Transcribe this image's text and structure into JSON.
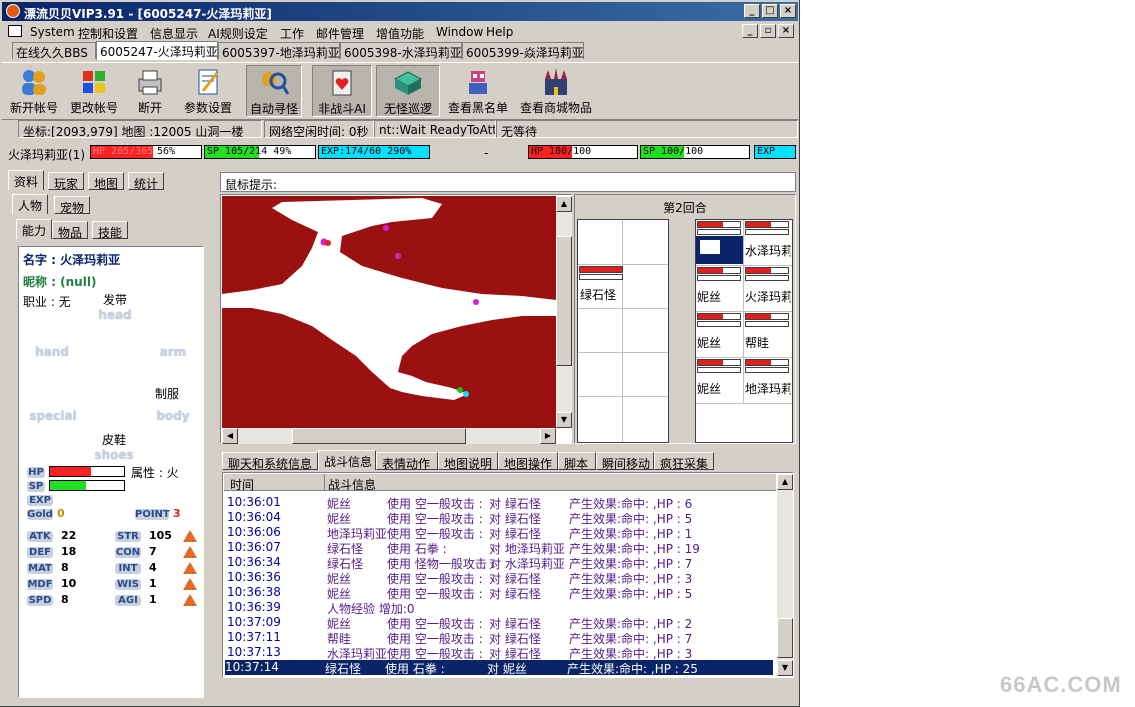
{
  "window": {
    "title": "漂流贝贝VIP3.91 - [6005247-火泽玛莉亚]"
  },
  "menu": [
    "System",
    "控制和设置",
    "信息显示",
    "AI规则设定",
    "工作",
    "邮件管理",
    "增值功能",
    "Window",
    "Help"
  ],
  "accounts": [
    "在线久久BBS",
    "6005247-火泽玛莉亚",
    "6005397-地泽玛莉亚",
    "6005398-水泽玛莉亚",
    "6005399-焱泽玛莉亚"
  ],
  "toolbar": [
    "新开帐号",
    "更改帐号",
    "断开",
    "参数设置",
    "自动寻怪",
    "非战斗AI",
    "无怪巡逻",
    "查看黑名单",
    "查看商城物品"
  ],
  "status": {
    "coord": "坐标:[2093,979] 地图 :12005 山洞一楼",
    "net": "网络空闲时间: 0秒",
    "state": "nt::Wait ReadyToAtt:",
    "wait": "无等待"
  },
  "party": {
    "name": "火泽玛莉亚(1)",
    "hp": "HP 205/365",
    "hp_pct": "56%",
    "hp_frac": 0.56,
    "sp": "SP 105/214 49%",
    "sp_frac": 0.49,
    "exp": "EXP:174/60 290%",
    "dash": "-",
    "pet_hp": "HP 100/100",
    "pet_sp": "SP 100/100",
    "pet_exp": "EXP"
  },
  "left_tabs": [
    "资料",
    "玩家",
    "地图",
    "统计"
  ],
  "sub_tabs": [
    "人物",
    "宠物"
  ],
  "sub_tabs2": [
    "能力",
    "物品",
    "技能"
  ],
  "char": {
    "name": "名字 : 火泽玛莉亚",
    "nick": "昵称 : (null)",
    "job": "职业 : 无",
    "head_item": "发带",
    "head": "head",
    "hand": "hand",
    "arm": "arm",
    "body_item": "制服",
    "special": "special",
    "body": "body",
    "shoes_item": "皮鞋",
    "shoes": "shoes",
    "hp_label": "HP",
    "sp_label": "SP",
    "exp_label": "EXP",
    "gold_label": "Gold",
    "gold": "0",
    "attr": "属性 : 火",
    "point_label": "POINT",
    "point": "3",
    "hp_frac": 0.56,
    "sp_frac": 0.49,
    "stats_left": [
      [
        "ATK",
        "22"
      ],
      [
        "DEF",
        "18"
      ],
      [
        "MAT",
        "8"
      ],
      [
        "MDF",
        "10"
      ],
      [
        "SPD",
        "8"
      ]
    ],
    "stats_right": [
      [
        "STR",
        "105"
      ],
      [
        "CON",
        "7"
      ],
      [
        "INT",
        "4"
      ],
      [
        "WIS",
        "1"
      ],
      [
        "AGI",
        "1"
      ]
    ]
  },
  "mouse_hint": "鼠标提示:",
  "battle": {
    "round": "第2回合",
    "enemy": [
      "绿石怪"
    ],
    "allies": [
      "水泽玛莉",
      "妮丝",
      "火泽玛莉",
      "妮丝",
      "帮眭",
      "妮丝",
      "地泽玛莉"
    ]
  },
  "info_tabs": [
    "聊天和系统信息",
    "战斗信息",
    "表情动作",
    "地图说明",
    "地图操作",
    "脚本",
    "瞬间移动",
    "疯狂采集"
  ],
  "log": {
    "col_time": "时间",
    "col_info": "战斗信息",
    "rows": [
      [
        "10:36:01",
        "妮丝",
        "使用 空一般攻击 :",
        "对 绿石怪",
        "产生效果:命中: ,HP : 6"
      ],
      [
        "10:36:04",
        "妮丝",
        "使用 空一般攻击 :",
        "对 绿石怪",
        "产生效果:命中: ,HP : 5"
      ],
      [
        "10:36:06",
        "地泽玛莉亚",
        "使用 空一般攻击 :",
        "对 绿石怪",
        "产生效果:命中: ,HP : 1"
      ],
      [
        "10:36:07",
        "绿石怪",
        "使用 石拳    :",
        "对 地泽玛莉亚",
        "产生效果:命中: ,HP : 19"
      ],
      [
        "10:36:34",
        "绿石怪",
        "使用 怪物一般攻击 :",
        "对 水泽玛莉亚",
        "产生效果:命中: ,HP : 7"
      ],
      [
        "10:36:36",
        "妮丝",
        "使用 空一般攻击 :",
        "对 绿石怪",
        "产生效果:命中: ,HP : 3"
      ],
      [
        "10:36:38",
        "妮丝",
        "使用 空一般攻击 :",
        "对 绿石怪",
        "产生效果:命中: ,HP : 5"
      ],
      [
        "10:36:39",
        "人物经验 增加:0",
        "",
        "",
        ""
      ],
      [
        "10:37:09",
        "妮丝",
        "使用 空一般攻击 :",
        "对 绿石怪",
        "产生效果:命中: ,HP : 2"
      ],
      [
        "10:37:11",
        "帮眭",
        "使用 空一般攻击 :",
        "对 绿石怪",
        "产生效果:命中: ,HP : 7"
      ],
      [
        "10:37:13",
        "水泽玛莉亚",
        "使用 空一般攻击 :",
        "对 绿石怪",
        "产生效果:命中: ,HP : 3"
      ],
      [
        "10:37:14",
        "绿石怪",
        "使用 石拳    :",
        "对 妮丝",
        "产生效果:命中: ,HP : 25"
      ]
    ]
  },
  "watermark": "66AC.COM",
  "colors": {
    "title_from": "#0a246a",
    "title_to": "#3a6ea5",
    "map_wall": "#9b1010",
    "hp": "#ff2020",
    "sp": "#20e020",
    "exp": "#00e0ff"
  }
}
